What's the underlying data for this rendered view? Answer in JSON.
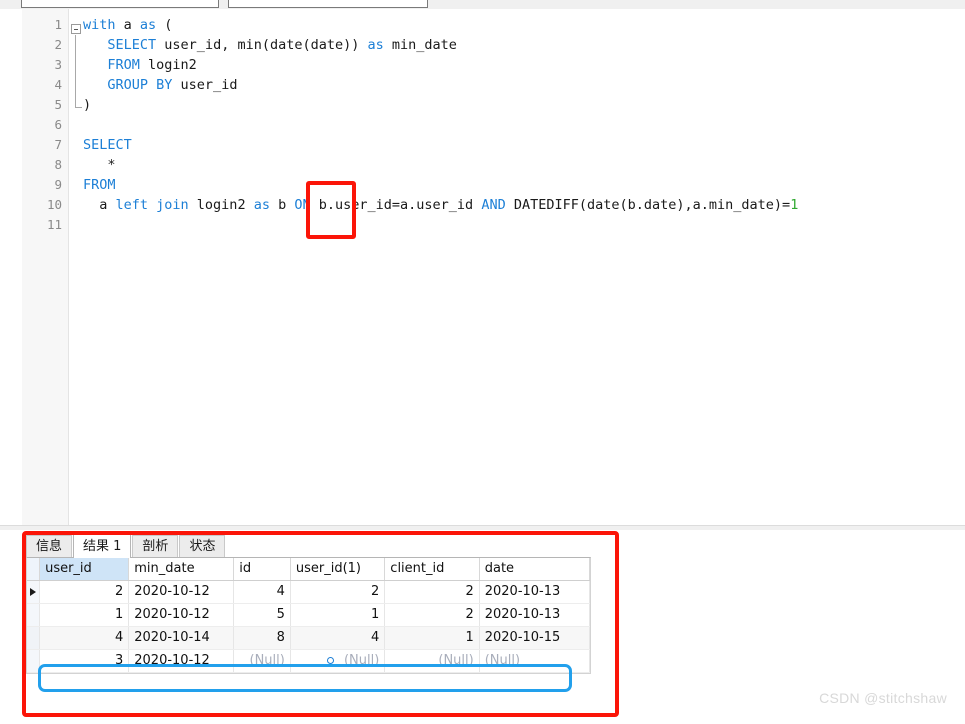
{
  "editor": {
    "gutter_numbers": [
      "1",
      "2",
      "3",
      "4",
      "5",
      "6",
      "7",
      "8",
      "9",
      "10",
      "11"
    ],
    "lines": [
      {
        "n": 1,
        "tokens": [
          {
            "t": "with",
            "c": "kw"
          },
          {
            "t": " a ",
            "c": "plain"
          },
          {
            "t": "as",
            "c": "kw"
          },
          {
            "t": " (",
            "c": "plain"
          }
        ]
      },
      {
        "n": 2,
        "tokens": [
          {
            "t": "   ",
            "c": "plain"
          },
          {
            "t": "SELECT",
            "c": "kw"
          },
          {
            "t": " user_id, min(date(date)) ",
            "c": "plain"
          },
          {
            "t": "as",
            "c": "kw"
          },
          {
            "t": " min_date",
            "c": "plain"
          }
        ]
      },
      {
        "n": 3,
        "tokens": [
          {
            "t": "   ",
            "c": "plain"
          },
          {
            "t": "FROM",
            "c": "kw"
          },
          {
            "t": " login2",
            "c": "plain"
          }
        ]
      },
      {
        "n": 4,
        "tokens": [
          {
            "t": "   ",
            "c": "plain"
          },
          {
            "t": "GROUP BY",
            "c": "kw"
          },
          {
            "t": " user_id",
            "c": "plain"
          }
        ]
      },
      {
        "n": 5,
        "tokens": [
          {
            "t": ")",
            "c": "plain"
          }
        ]
      },
      {
        "n": 6,
        "tokens": [
          {
            "t": "",
            "c": "plain"
          }
        ]
      },
      {
        "n": 7,
        "tokens": [
          {
            "t": "SELECT",
            "c": "kw"
          }
        ]
      },
      {
        "n": 8,
        "tokens": [
          {
            "t": "   *",
            "c": "plain"
          }
        ]
      },
      {
        "n": 9,
        "tokens": [
          {
            "t": "FROM",
            "c": "kw"
          }
        ]
      },
      {
        "n": 10,
        "tokens": [
          {
            "t": "  a ",
            "c": "plain"
          },
          {
            "t": "left join",
            "c": "kw"
          },
          {
            "t": " login2 ",
            "c": "plain"
          },
          {
            "t": "as",
            "c": "kw"
          },
          {
            "t": " b ",
            "c": "plain"
          },
          {
            "t": "ON",
            "c": "kw"
          },
          {
            "t": " b.user_id=a.user_id ",
            "c": "plain"
          },
          {
            "t": "AND",
            "c": "kw"
          },
          {
            "t": " DATEDIFF(date(b.date),a.min_date)=",
            "c": "plain"
          },
          {
            "t": "1",
            "c": "num"
          }
        ]
      },
      {
        "n": 11,
        "tokens": [
          {
            "t": "",
            "c": "plain"
          }
        ]
      }
    ],
    "full_sql": "with a as (\n   SELECT user_id, min(date(date)) as min_date\n   FROM login2\n   GROUP BY user_id\n)\n\nSELECT\n   *\nFROM\n  a left join login2 as b ON b.user_id=a.user_id AND DATEDIFF(date(b.date),a.min_date)=1\n"
  },
  "annotations": {
    "on_keyword_box_color": "#fb1508",
    "result_panel_box_color": "#fb1508",
    "null_row_box_color": "#22a0ec"
  },
  "result_panel": {
    "tabs": [
      {
        "label": "信息",
        "active": false
      },
      {
        "label": "结果 1",
        "active": true
      },
      {
        "label": "剖析",
        "active": false
      },
      {
        "label": "状态",
        "active": false
      }
    ],
    "columns": [
      "user_id",
      "min_date",
      "id",
      "user_id(1)",
      "client_id",
      "date"
    ],
    "selected_column": "user_id",
    "rows": [
      {
        "marker": true,
        "stripe": false,
        "highlighted": false,
        "cells": [
          {
            "v": "2",
            "align": "numeric",
            "null": false
          },
          {
            "v": "2020-10-12",
            "align": "textual",
            "null": false
          },
          {
            "v": "4",
            "align": "numeric",
            "null": false
          },
          {
            "v": "2",
            "align": "numeric",
            "null": false
          },
          {
            "v": "2",
            "align": "numeric",
            "null": false
          },
          {
            "v": "2020-10-13",
            "align": "textual",
            "null": false
          }
        ]
      },
      {
        "marker": false,
        "stripe": false,
        "highlighted": false,
        "cells": [
          {
            "v": "1",
            "align": "numeric",
            "null": false
          },
          {
            "v": "2020-10-12",
            "align": "textual",
            "null": false
          },
          {
            "v": "5",
            "align": "numeric",
            "null": false
          },
          {
            "v": "1",
            "align": "numeric",
            "null": false
          },
          {
            "v": "2",
            "align": "numeric",
            "null": false
          },
          {
            "v": "2020-10-13",
            "align": "textual",
            "null": false
          }
        ]
      },
      {
        "marker": false,
        "stripe": true,
        "highlighted": false,
        "cells": [
          {
            "v": "4",
            "align": "numeric",
            "null": false
          },
          {
            "v": "2020-10-14",
            "align": "textual",
            "null": false
          },
          {
            "v": "8",
            "align": "numeric",
            "null": false
          },
          {
            "v": "4",
            "align": "numeric",
            "null": false
          },
          {
            "v": "1",
            "align": "numeric",
            "null": false
          },
          {
            "v": "2020-10-15",
            "align": "textual",
            "null": false
          }
        ]
      },
      {
        "marker": false,
        "stripe": false,
        "highlighted": true,
        "cells": [
          {
            "v": "3",
            "align": "numeric",
            "null": false
          },
          {
            "v": "2020-10-12",
            "align": "textual",
            "null": false
          },
          {
            "v": "(Null)",
            "align": "numeric",
            "null": true
          },
          {
            "v": "(Null)",
            "align": "numeric",
            "null": true,
            "dot": true
          },
          {
            "v": "(Null)",
            "align": "numeric",
            "null": true
          },
          {
            "v": "(Null)",
            "align": "textual",
            "null": true
          }
        ]
      }
    ]
  },
  "watermark": {
    "text": "CSDN @stitchshaw"
  }
}
